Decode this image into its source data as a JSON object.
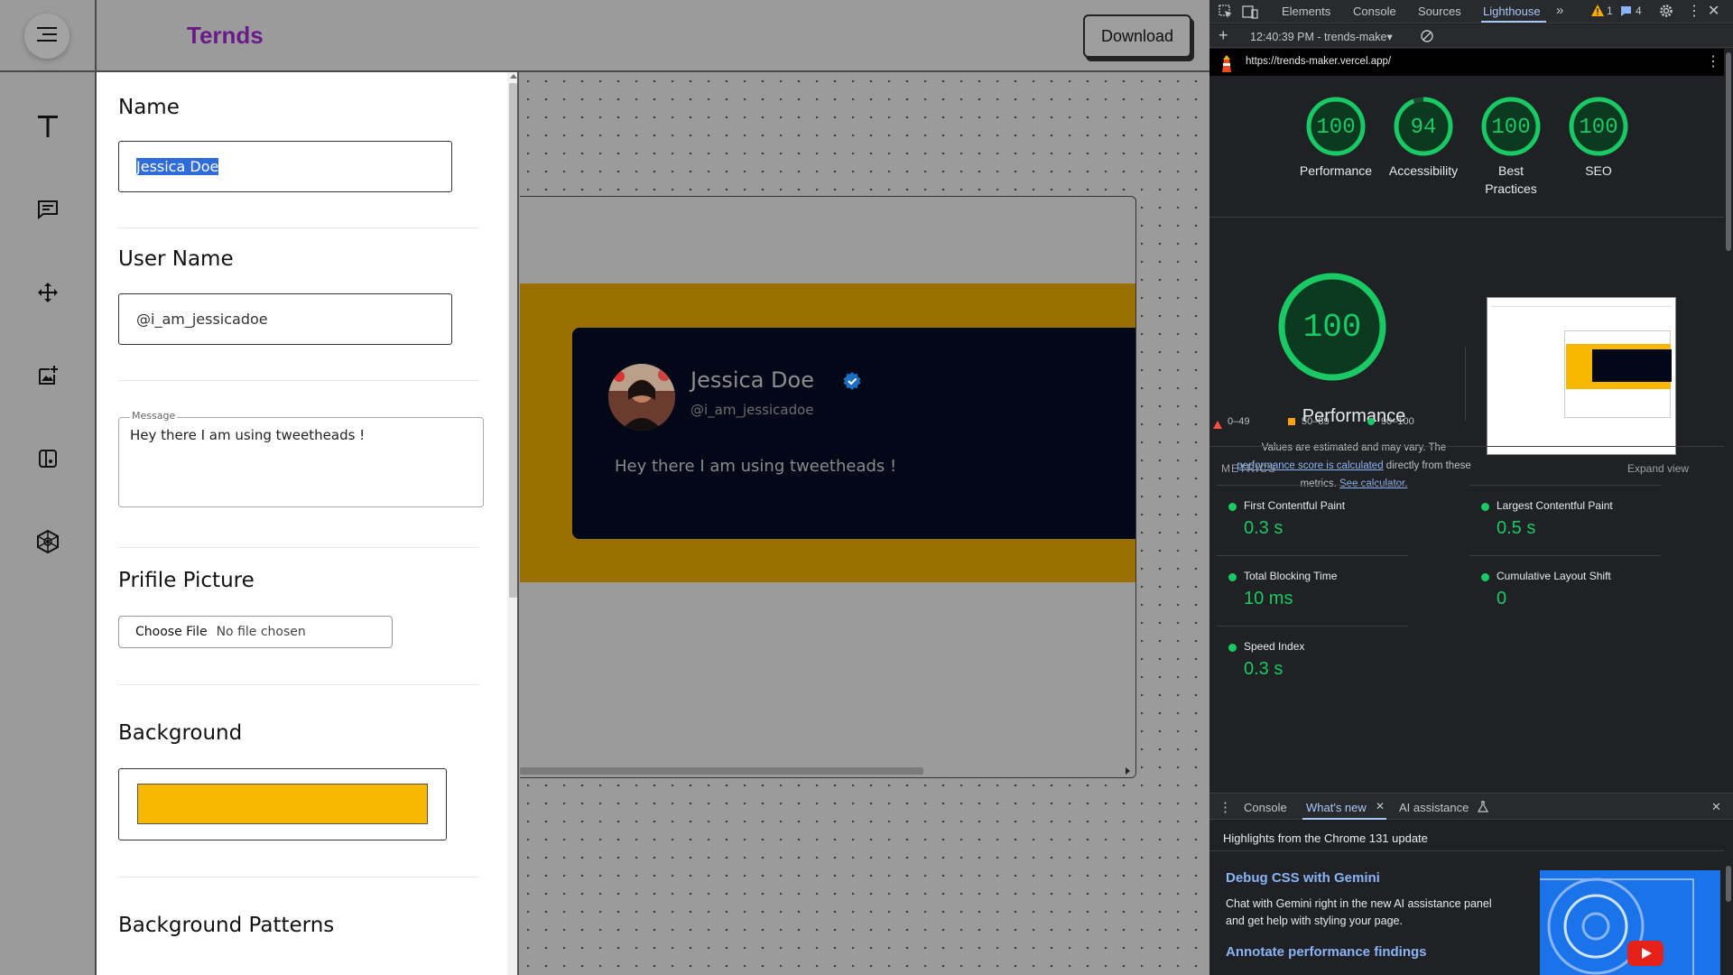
{
  "app": {
    "brand": "Ternds",
    "download_label": "Download"
  },
  "form": {
    "name_label": "Name",
    "name_value": "Jessica Doe",
    "username_label": "User Name",
    "username_value": "@i_am_jessicadoe",
    "message_label": "Message",
    "message_value": "Hey there I am using tweetheads !",
    "picture_label": "Prifile Picture",
    "choose_file": "Choose File",
    "no_file": "No file chosen",
    "background_label": "Background",
    "background_color": "#f9b800",
    "patterns_label": "Background Patterns"
  },
  "preview": {
    "name": "Jessica Doe",
    "username": "@i_am_jessicadoe",
    "message": "Hey there I am using tweetheads !",
    "band_color": "#996f00",
    "card_color": "#020817"
  },
  "devtools": {
    "tabs": [
      "Elements",
      "Console",
      "Sources",
      "Lighthouse"
    ],
    "active_tab": "Lighthouse",
    "warnings": "1",
    "issues": "4",
    "report_label": "12:40:39 PM - trends-make",
    "url": "https://trends-maker.vercel.app/",
    "scores": [
      {
        "value": "100",
        "label": "Performance"
      },
      {
        "value": "94",
        "label": "Accessibility"
      },
      {
        "value": "100",
        "label": "Best Practices"
      },
      {
        "value": "100",
        "label": "SEO"
      }
    ],
    "main_score": "100",
    "main_label": "Performance",
    "note_1": "Values are estimated and may vary. The",
    "note_link_1": "performance score is calculated",
    "note_2": "directly from these",
    "note_3": "metrics.",
    "note_link_2": "See calculator.",
    "legend": [
      "0–49",
      "50–89",
      "90–100"
    ],
    "metrics_label": "METRICS",
    "expand_label": "Expand view",
    "metrics": [
      {
        "name": "First Contentful Paint",
        "value": "0.3 s"
      },
      {
        "name": "Largest Contentful Paint",
        "value": "0.5 s"
      },
      {
        "name": "Total Blocking Time",
        "value": "10 ms"
      },
      {
        "name": "Cumulative Layout Shift",
        "value": "0"
      },
      {
        "name": "Speed Index",
        "value": "0.3 s"
      }
    ],
    "drawer_tabs": [
      "Console",
      "What's new",
      "AI assistance"
    ],
    "whatsnew_heading": "Highlights from the Chrome 131 update",
    "wn_title_1": "Debug CSS with Gemini",
    "wn_text_1": "Chat with Gemini right in the new AI assistance panel and get help with styling your page.",
    "wn_title_2": "Annotate performance findings",
    "colors": {
      "good": "#18c964",
      "average": "#ffa400",
      "poor": "#ff4e42",
      "link": "#8ab4f8"
    }
  }
}
